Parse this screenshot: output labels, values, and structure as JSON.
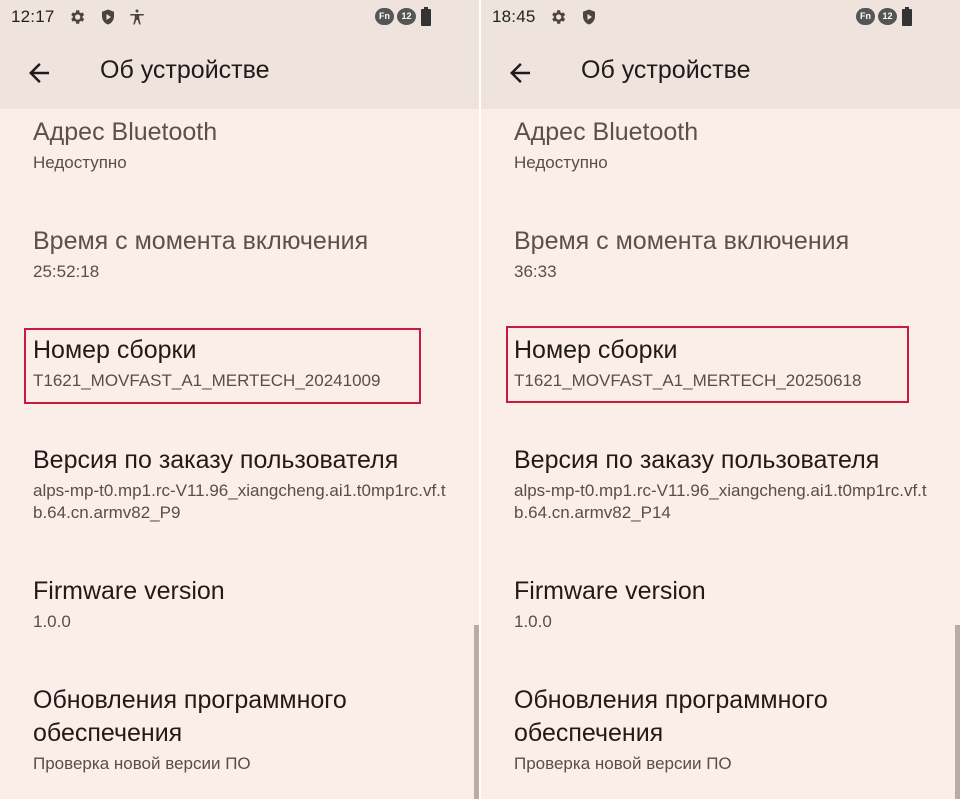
{
  "screens": [
    {
      "status_time": "12:17",
      "status_icons": [
        "gear-icon",
        "shield-icon",
        "accessibility-icon"
      ],
      "fn_badge": "Fn",
      "sim_badge": "12",
      "title": "Об устройстве",
      "items": [
        {
          "title": "Адрес Bluetooth",
          "subtitle": "Недоступно"
        },
        {
          "title": "Время с момента включения",
          "subtitle": "25:52:18"
        },
        {
          "title": "Номер сборки",
          "subtitle": "T1621_MOVFAST_A1_MERTECH_20241009"
        },
        {
          "title": "Версия по заказу пользователя",
          "subtitle": "alps-mp-t0.mp1.rc-V11.96_xiangcheng.ai1.t0mp1rc.vf.tb.64.cn.armv82_P9"
        },
        {
          "title": "Firmware version",
          "subtitle": "1.0.0"
        },
        {
          "title": "Обновления программного обеспечения",
          "subtitle": "Проверка новой версии ПО"
        }
      ]
    },
    {
      "status_time": "18:45",
      "status_icons": [
        "gear-icon",
        "shield-icon"
      ],
      "fn_badge": "Fn",
      "sim_badge": "12",
      "title": "Об устройстве",
      "items": [
        {
          "title": "Адрес Bluetooth",
          "subtitle": "Недоступно"
        },
        {
          "title": "Время с момента включения",
          "subtitle": "36:33"
        },
        {
          "title": "Номер сборки",
          "subtitle": "T1621_MOVFAST_A1_MERTECH_20250618"
        },
        {
          "title": "Версия по заказу пользователя",
          "subtitle": "alps-mp-t0.mp1.rc-V11.96_xiangcheng.ai1.t0mp1rc.vf.tb.64.cn.armv82_P14"
        },
        {
          "title": "Firmware version",
          "subtitle": "1.0.0"
        },
        {
          "title": "Обновления программного обеспечения",
          "subtitle": "Проверка новой версии ПО"
        }
      ]
    }
  ],
  "colors": {
    "background": "#fbeee9",
    "appbar": "#efe3de",
    "highlight_border": "#c8193f",
    "text_primary": "#211a18",
    "text_secondary": "#5a4d48"
  }
}
